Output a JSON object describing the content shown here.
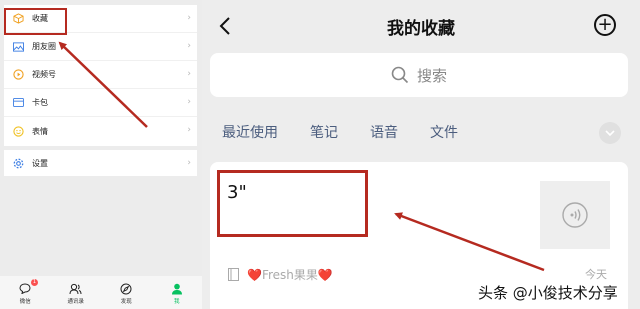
{
  "left_menu": {
    "items": [
      {
        "label": "收藏",
        "icon": "cube-icon"
      },
      {
        "label": "朋友圈",
        "icon": "photo-icon"
      },
      {
        "label": "视频号",
        "icon": "play-circle-icon"
      },
      {
        "label": "卡包",
        "icon": "card-wallet-icon"
      },
      {
        "label": "表情",
        "icon": "smiley-icon"
      }
    ],
    "settings": {
      "label": "设置",
      "icon": "gear-icon"
    },
    "chevron": "›"
  },
  "tabbar": {
    "tabs": [
      {
        "label": "微信",
        "icon": "chat-bubble-icon",
        "badge": "1"
      },
      {
        "label": "通讯录",
        "icon": "contacts-icon"
      },
      {
        "label": "发现",
        "icon": "compass-icon"
      },
      {
        "label": "我",
        "icon": "person-icon",
        "active": true
      }
    ]
  },
  "right": {
    "title": "我的收藏",
    "add": "+",
    "search_placeholder": "搜索",
    "filters": [
      "最近使用",
      "笔记",
      "语音",
      "文件"
    ],
    "card": {
      "text": "3\"",
      "source": "❤️Fresh果果❤️",
      "date": "今天"
    }
  },
  "watermark": "头条 @小俊技术分享",
  "colors": {
    "highlight": "#b52a20",
    "wechat_green": "#07c160",
    "badge_red": "#fa5151",
    "filter_text": "#4b5d7e"
  }
}
